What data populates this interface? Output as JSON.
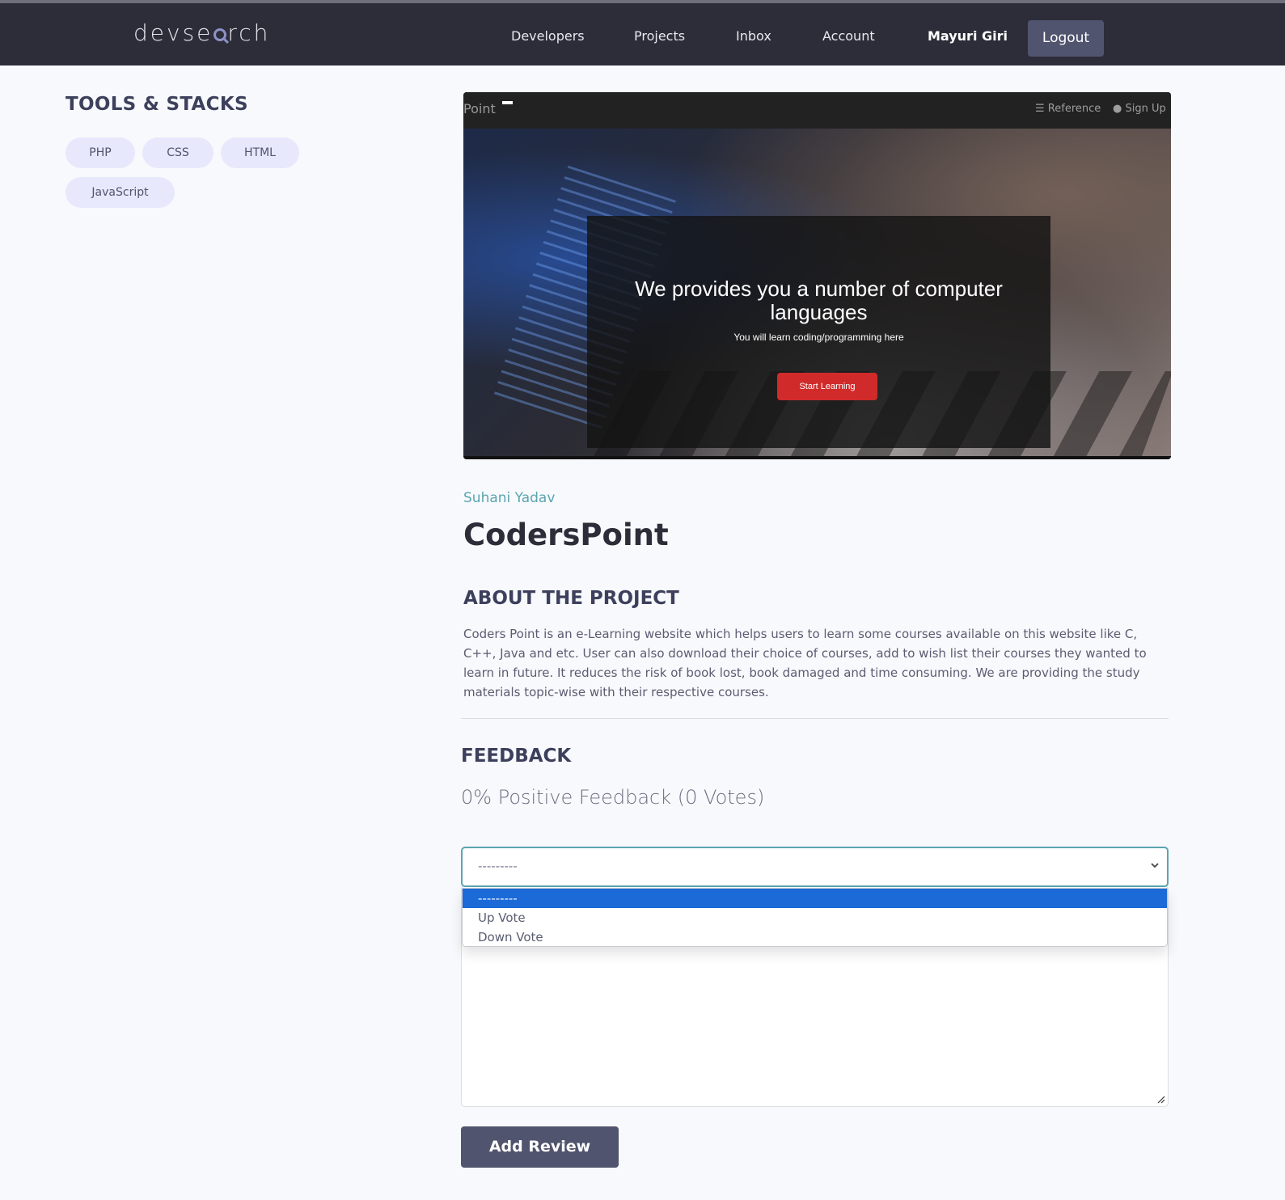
{
  "header": {
    "logo_left": "devse",
    "logo_right": "rch",
    "nav": [
      "Developers",
      "Projects",
      "Inbox",
      "Account"
    ],
    "user_name": "Mayuri Giri",
    "logout_label": "Logout"
  },
  "sidebar": {
    "title": "TOOLS & STACKS",
    "tags": [
      "PHP",
      "CSS",
      "HTML",
      "JavaScript"
    ]
  },
  "hero": {
    "brand": "Point",
    "links": [
      "Reference",
      "Sign Up"
    ],
    "heading": "We provides you a number of computer languages",
    "subheading": "You will learn coding/programming here",
    "button_label": "Start Learning"
  },
  "project": {
    "owner": "Suhani Yadav",
    "title": "CodersPoint",
    "about_title": "ABOUT THE PROJECT",
    "description": "Coders Point is an e-Learning website which helps users to learn some courses available on this website like C, C++, Java and etc. User can also download their choice of courses, add to wish list their courses they wanted to learn in future. It reduces the risk of book lost, book damaged and time consuming. We are providing the study materials topic-wise with their respective courses."
  },
  "feedback": {
    "title": "FEEDBACK",
    "stats": "0% Positive Feedback (0 Votes)",
    "select_value": "---------",
    "options": [
      "---------",
      "Up Vote",
      "Down Vote"
    ],
    "submit_label": "Add Review"
  },
  "colors": {
    "topbar": "#2d2d39",
    "accent": "#5aa5b0",
    "primary_button": "#51546e",
    "tag_bg": "#e8e8fc",
    "option_highlight": "#1b6ad8",
    "hero_cta": "#d12a2a"
  }
}
